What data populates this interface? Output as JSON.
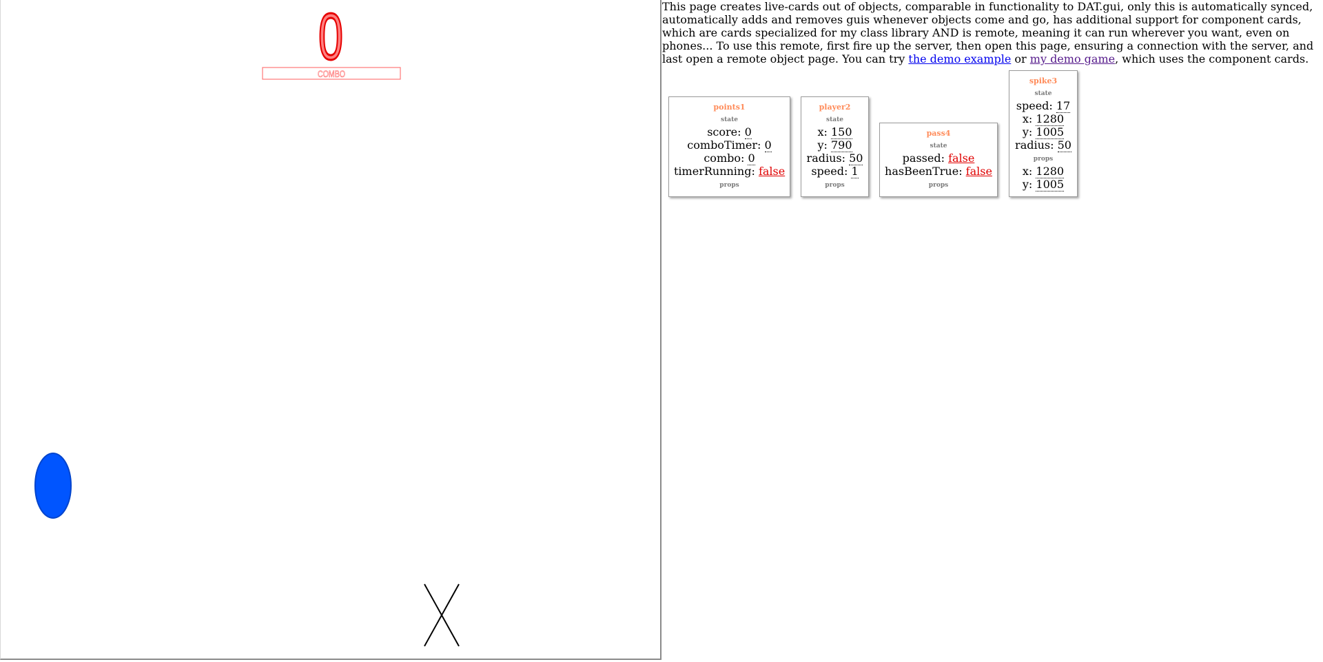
{
  "game": {
    "score_display": "0",
    "combo_label": "COMBO",
    "colors": {
      "score_red": "#ff2a2a",
      "player_blue": "#0055ff",
      "player_stroke": "#0044cc",
      "spike_black": "#000000"
    }
  },
  "remote": {
    "intro_text_before": "This page creates live-cards out of objects, comparable in functionality to DAT.gui, only this is automatically synced, automatically adds and removes guis whenever objects come and go, has additional support for component cards, which are cards specialized for my class library AND is remote, meaning it can run wherever you want, even on phones... To use this remote, first fire up the server, then open this page, ensuring a connection with the server, and last open a remote object page. You can try ",
    "link_demo_example": "the demo example",
    "text_or": " or ",
    "link_demo_game": "my demo game",
    "intro_text_after": ", which uses the component cards.",
    "cards": {
      "points1": {
        "title": "points1",
        "state_label": "state",
        "props_label": "props",
        "rows": [
          {
            "key": "score: ",
            "value": "0"
          },
          {
            "key": "comboTimer: ",
            "value": "0"
          },
          {
            "key": "combo: ",
            "value": "0"
          },
          {
            "key": "timerRunning: ",
            "value": "false"
          }
        ]
      },
      "player2": {
        "title": "player2",
        "state_label": "state",
        "props_label": "props",
        "rows": [
          {
            "key": "x: ",
            "value": "150"
          },
          {
            "key": "y: ",
            "value": "790"
          },
          {
            "key": "radius: ",
            "value": "50"
          },
          {
            "key": "speed: ",
            "value": "1"
          }
        ]
      },
      "pass4": {
        "title": "pass4",
        "state_label": "state",
        "props_label": "props",
        "rows": [
          {
            "key": "passed: ",
            "value": "false"
          },
          {
            "key": "hasBeenTrue: ",
            "value": "false"
          }
        ]
      },
      "spike3": {
        "title": "spike3",
        "state_label": "state",
        "props_label": "props",
        "state_rows": [
          {
            "key": "speed: ",
            "value": "17"
          },
          {
            "key": "x: ",
            "value": "1280"
          },
          {
            "key": "y: ",
            "value": "1005"
          },
          {
            "key": "radius: ",
            "value": "50"
          }
        ],
        "props_rows": [
          {
            "key": "x: ",
            "value": "1280"
          },
          {
            "key": "y: ",
            "value": "1005"
          }
        ]
      }
    }
  }
}
